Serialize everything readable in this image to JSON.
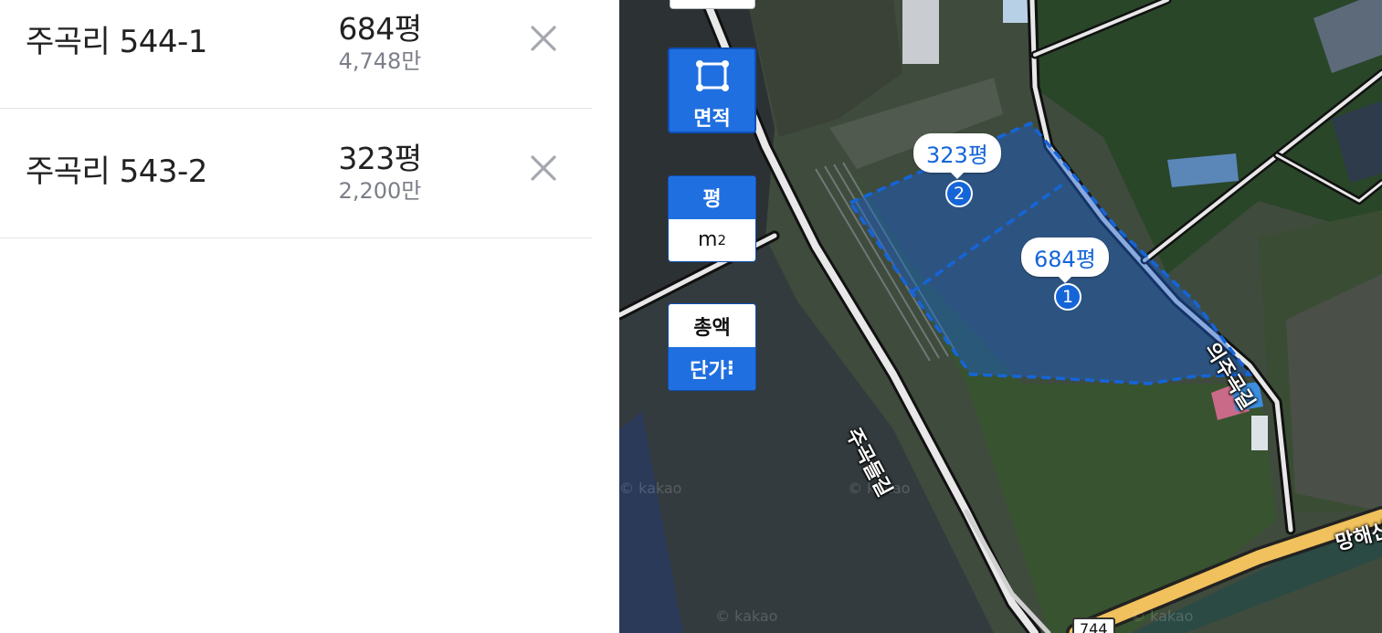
{
  "parcels": [
    {
      "number": "1",
      "name": "주곡리 544-1",
      "area": "684평",
      "price": "4,748만"
    },
    {
      "number": "2",
      "name": "주곡리 543-2",
      "area": "323평",
      "price": "2,200만"
    }
  ],
  "controls": {
    "area_label": "면적",
    "unit_pyeong": "평",
    "unit_m2": "m",
    "unit_m2_sup": "2",
    "mode_total": "총액",
    "mode_unit_price": "단가",
    "more_icon": "⁝"
  },
  "map": {
    "road_labels": [
      "주곡들길",
      "의주곡길",
      "망해산"
    ],
    "route_number": "744",
    "watermark": "© kakao"
  },
  "colors": {
    "accent": "#1f6fe0",
    "marker": "#1565d8",
    "polygon": "#1565d8"
  }
}
